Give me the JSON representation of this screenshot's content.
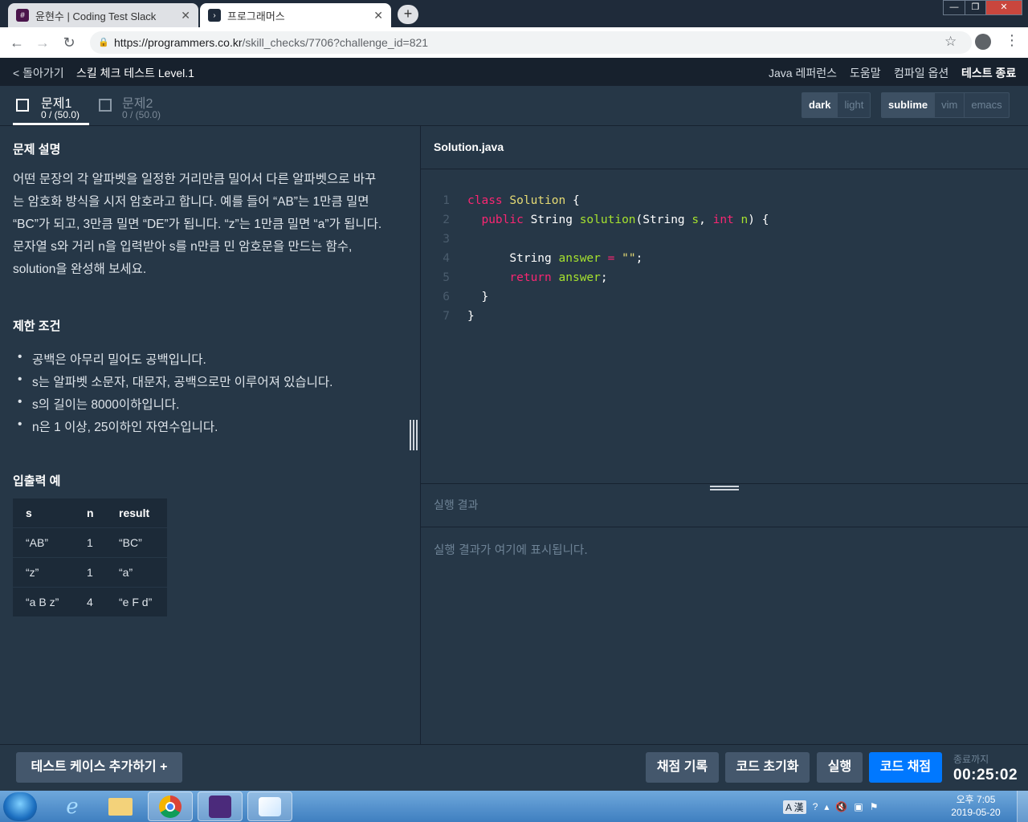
{
  "browser": {
    "tabs": [
      {
        "label": "윤현수 | Coding Test Slack",
        "active": false
      },
      {
        "label": "프로그래머스",
        "active": true
      }
    ],
    "new_tab_icon": "+",
    "url_host": "https://programmers.co.kr",
    "url_path": "/skill_checks/7706?challenge_id=821"
  },
  "header": {
    "back": "< 돌아가기",
    "title": "스킬 체크 테스트 Level.1",
    "java_ref": "Java 레퍼런스",
    "help": "도움말",
    "compile_options": "컴파일 옵션",
    "end_test": "테스트 종료"
  },
  "problem_tabs": [
    {
      "title": "문제1",
      "score": "0 / (50.0)",
      "active": true
    },
    {
      "title": "문제2",
      "score": "0 / (50.0)",
      "active": false
    }
  ],
  "theme_options": [
    "dark",
    "light"
  ],
  "theme_selected": "dark",
  "keymap_options": [
    "sublime",
    "vim",
    "emacs"
  ],
  "keymap_selected": "sublime",
  "problem": {
    "desc_heading": "문제 설명",
    "description": "어떤 문장의 각 알파벳을 일정한 거리만큼 밀어서 다른 알파벳으로 바꾸는 암호화 방식을 시저 암호라고 합니다. 예를 들어 “AB”는 1만큼 밀면 “BC”가 되고, 3만큼 밀면 “DE”가 됩니다. “z”는 1만큼 밀면 “a”가 됩니다. 문자열 s와 거리 n을 입력받아 s를 n만큼 민 암호문을 만드는 함수, solution을 완성해 보세요.",
    "constraints_heading": "제한 조건",
    "constraints": [
      "공백은 아무리 밀어도 공백입니다.",
      "s는 알파벳 소문자, 대문자, 공백으로만 이루어져 있습니다.",
      "s의 길이는 8000이하입니다.",
      "n은 1 이상, 25이하인 자연수입니다."
    ],
    "io_heading": "입출력 예",
    "io_columns": [
      "s",
      "n",
      "result"
    ],
    "io_rows": [
      [
        "“AB”",
        "1",
        "“BC”"
      ],
      [
        "“z”",
        "1",
        "“a”"
      ],
      [
        "“a B z”",
        "4",
        "“e F d”"
      ]
    ]
  },
  "editor": {
    "filename": "Solution.java",
    "line_numbers": [
      "1",
      "2",
      "3",
      "4",
      "5",
      "6",
      "7"
    ]
  },
  "result": {
    "heading": "실행 결과",
    "placeholder": "실행 결과가 여기에 표시됩니다."
  },
  "footer": {
    "add_testcase": "테스트 케이스 추가하기 +",
    "history": "채점 기록",
    "reset": "코드 초기화",
    "run": "실행",
    "submit": "코드 채점",
    "timer_label": "종료까지",
    "timer": "00:25:02"
  },
  "taskbar": {
    "ime": "A 漢",
    "clock_time": "오후 7:05",
    "clock_date": "2019-05-20"
  },
  "colors": {
    "bg": "#263747",
    "header_bg": "#17212d",
    "primary_button": "#0078ff"
  }
}
